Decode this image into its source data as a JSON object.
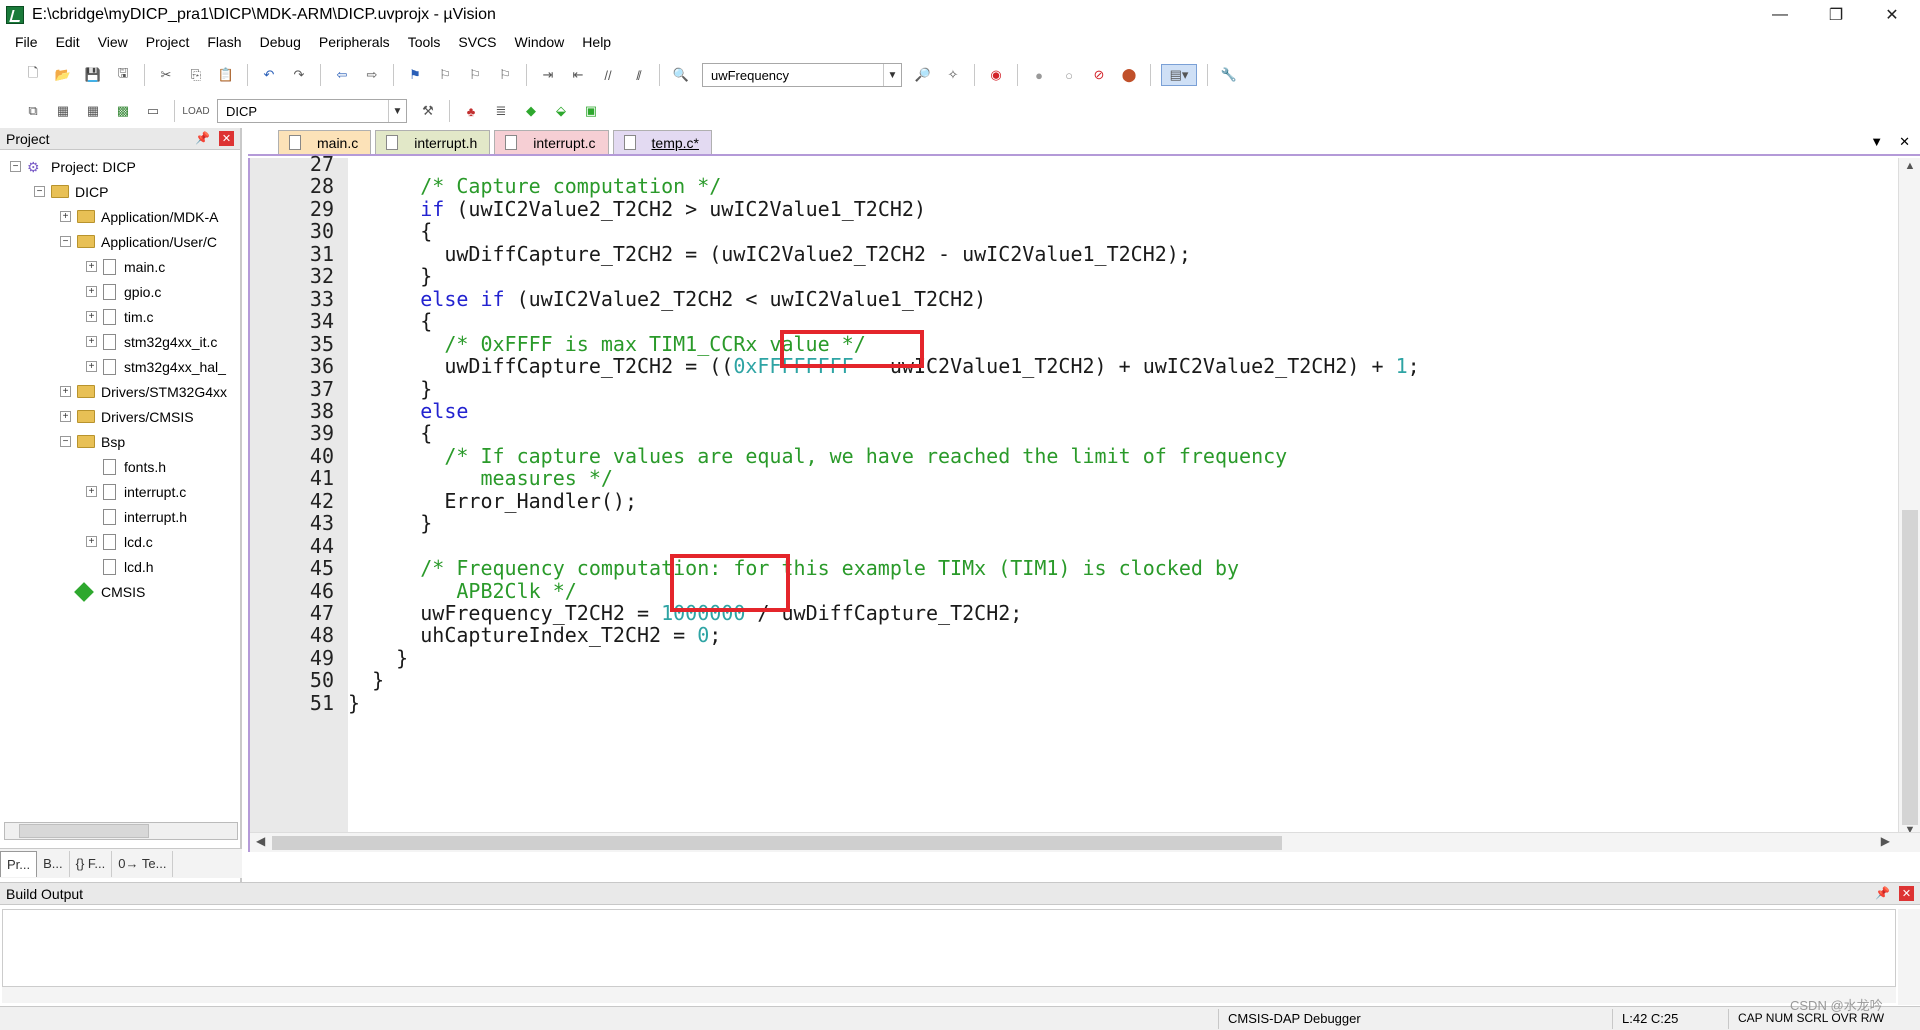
{
  "window": {
    "title": "E:\\cbridge\\myDICP_pra1\\DICP\\MDK-ARM\\DICP.uvprojx - µVision",
    "minimize": "—",
    "maximize": "❐",
    "close": "✕"
  },
  "menu": [
    "File",
    "Edit",
    "View",
    "Project",
    "Flash",
    "Debug",
    "Peripherals",
    "Tools",
    "SVCS",
    "Window",
    "Help"
  ],
  "toolbar": {
    "find_combo": "uwFrequency",
    "target_combo": "DICP"
  },
  "project_panel": {
    "title": "Project",
    "tree": [
      {
        "label": "Project: DICP",
        "level": 0,
        "kind": "project",
        "expander": "−"
      },
      {
        "label": "DICP",
        "level": 1,
        "kind": "folder",
        "expander": "−"
      },
      {
        "label": "Application/MDK-A",
        "level": 2,
        "kind": "folder",
        "expander": "+"
      },
      {
        "label": "Application/User/C",
        "level": 2,
        "kind": "folder",
        "expander": "−"
      },
      {
        "label": "main.c",
        "level": 3,
        "kind": "file",
        "expander": "+"
      },
      {
        "label": "gpio.c",
        "level": 3,
        "kind": "file",
        "expander": "+"
      },
      {
        "label": "tim.c",
        "level": 3,
        "kind": "file",
        "expander": "+"
      },
      {
        "label": "stm32g4xx_it.c",
        "level": 3,
        "kind": "file",
        "expander": "+"
      },
      {
        "label": "stm32g4xx_hal_",
        "level": 3,
        "kind": "file",
        "expander": "+"
      },
      {
        "label": "Drivers/STM32G4xx",
        "level": 2,
        "kind": "folder",
        "expander": "+"
      },
      {
        "label": "Drivers/CMSIS",
        "level": 2,
        "kind": "folder",
        "expander": "+"
      },
      {
        "label": "Bsp",
        "level": 2,
        "kind": "folder",
        "expander": "−"
      },
      {
        "label": "fonts.h",
        "level": 3,
        "kind": "file",
        "expander": ""
      },
      {
        "label": "interrupt.c",
        "level": 3,
        "kind": "file",
        "expander": "+"
      },
      {
        "label": "interrupt.h",
        "level": 3,
        "kind": "file",
        "expander": ""
      },
      {
        "label": "lcd.c",
        "level": 3,
        "kind": "file",
        "expander": "+"
      },
      {
        "label": "lcd.h",
        "level": 3,
        "kind": "file",
        "expander": ""
      },
      {
        "label": "CMSIS",
        "level": 2,
        "kind": "component",
        "expander": ""
      }
    ],
    "tabs": [
      "Pr...",
      "B...",
      "{} F...",
      "0→ Te..."
    ]
  },
  "editor_tabs": [
    "main.c",
    "interrupt.h",
    "interrupt.c",
    "temp.c*"
  ],
  "code_lines": [
    {
      "n": "27",
      "tokens": []
    },
    {
      "n": "28",
      "tokens": [
        [
          "plain",
          "      "
        ],
        [
          "cm",
          "/* Capture computation */"
        ]
      ]
    },
    {
      "n": "29",
      "tokens": [
        [
          "plain",
          "      "
        ],
        [
          "kw",
          "if"
        ],
        [
          "plain",
          " (uwIC2Value2_T2CH2 > uwIC2Value1_T2CH2)"
        ]
      ]
    },
    {
      "n": "30",
      "tokens": [
        [
          "plain",
          "      {"
        ]
      ]
    },
    {
      "n": "31",
      "tokens": [
        [
          "plain",
          "        uwDiffCapture_T2CH2 = (uwIC2Value2_T2CH2 - uwIC2Value1_T2CH2);"
        ]
      ]
    },
    {
      "n": "32",
      "tokens": [
        [
          "plain",
          "      }"
        ]
      ]
    },
    {
      "n": "33",
      "tokens": [
        [
          "plain",
          "      "
        ],
        [
          "kw",
          "else if"
        ],
        [
          "plain",
          " (uwIC2Value2_T2CH2 < uwIC2Value1_T2CH2)"
        ]
      ]
    },
    {
      "n": "34",
      "tokens": [
        [
          "plain",
          "      {"
        ]
      ]
    },
    {
      "n": "35",
      "tokens": [
        [
          "plain",
          "        "
        ],
        [
          "cm",
          "/* 0xFFFF is max TIM1_CCRx value */"
        ]
      ]
    },
    {
      "n": "36",
      "tokens": [
        [
          "plain",
          "        uwDiffCapture_T2CH2 = (("
        ],
        [
          "num",
          "0xFFFFFFFF"
        ],
        [
          "plain",
          " - uwIC2Value1_T2CH2) + uwIC2Value2_T2CH2) + "
        ],
        [
          "num",
          "1"
        ],
        [
          "plain",
          ";"
        ]
      ]
    },
    {
      "n": "37",
      "tokens": [
        [
          "plain",
          "      }"
        ]
      ]
    },
    {
      "n": "38",
      "tokens": [
        [
          "plain",
          "      "
        ],
        [
          "kw",
          "else"
        ]
      ]
    },
    {
      "n": "39",
      "tokens": [
        [
          "plain",
          "      {"
        ]
      ]
    },
    {
      "n": "40",
      "tokens": [
        [
          "plain",
          "        "
        ],
        [
          "cm",
          "/* If capture values are equal, we have reached the limit of frequency"
        ]
      ]
    },
    {
      "n": "41",
      "tokens": [
        [
          "cm",
          "           measures */"
        ]
      ]
    },
    {
      "n": "42",
      "tokens": [
        [
          "plain",
          "        Error_Handler();"
        ]
      ]
    },
    {
      "n": "43",
      "tokens": [
        [
          "plain",
          "      }"
        ]
      ]
    },
    {
      "n": "44",
      "tokens": []
    },
    {
      "n": "45",
      "tokens": [
        [
          "plain",
          "      "
        ],
        [
          "cm",
          "/* Frequency computation: for this example TIMx (TIM1) is clocked by"
        ]
      ]
    },
    {
      "n": "46",
      "tokens": [
        [
          "cm",
          "         APB2Clk */"
        ]
      ]
    },
    {
      "n": "47",
      "tokens": [
        [
          "plain",
          "      uwFrequency_T2CH2 = "
        ],
        [
          "num",
          "1000000"
        ],
        [
          "plain",
          " / uwDiffCapture_T2CH2;"
        ]
      ]
    },
    {
      "n": "48",
      "tokens": [
        [
          "plain",
          "      uhCaptureIndex_T2CH2 = "
        ],
        [
          "num",
          "0"
        ],
        [
          "plain",
          ";"
        ]
      ]
    },
    {
      "n": "49",
      "tokens": [
        [
          "plain",
          "    }"
        ]
      ]
    },
    {
      "n": "50",
      "tokens": [
        [
          "plain",
          "  }"
        ]
      ]
    },
    {
      "n": "51",
      "tokens": [
        [
          "plain",
          "}"
        ]
      ]
    }
  ],
  "build_output": {
    "title": "Build Output",
    "content": ""
  },
  "status_bar": {
    "debugger": "CMSIS-DAP Debugger",
    "position": "L:42 C:25",
    "flags": "CAP  NUM  SCRL  OVR  R/W",
    "watermark": "CSDN @水龙吟"
  },
  "colors": {
    "keyword": "#2323d0",
    "comment": "#2a9a2a",
    "number": "#2ea4a4",
    "highlight_box": "#e4252b",
    "active_tab_border": "#b49ad8"
  }
}
